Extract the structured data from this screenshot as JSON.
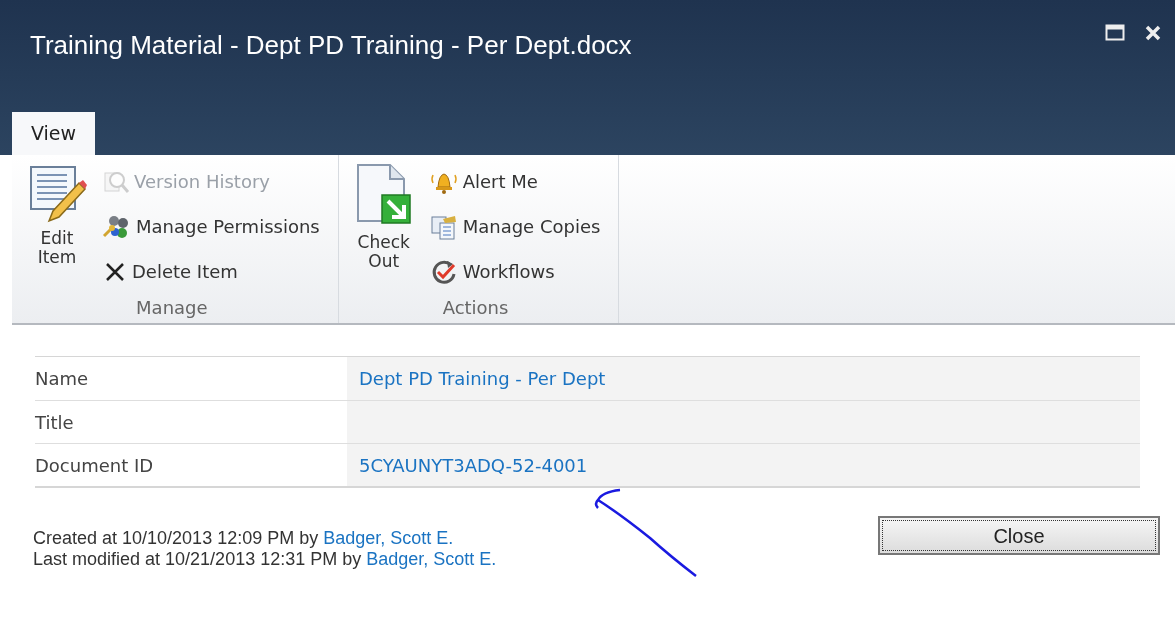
{
  "window": {
    "title": "Training Material - Dept PD Training - Per Dept.docx"
  },
  "tabs": [
    {
      "label": "View",
      "selected": true
    }
  ],
  "ribbon": {
    "groups": [
      {
        "label": "Manage",
        "buttons": [
          {
            "kind": "large",
            "label": "Edit Item",
            "disabled": false
          },
          {
            "kind": "small",
            "label": "Version History",
            "disabled": true
          },
          {
            "kind": "small",
            "label": "Manage Permissions",
            "disabled": false
          },
          {
            "kind": "small",
            "label": "Delete Item",
            "disabled": false
          }
        ]
      },
      {
        "label": "Actions",
        "buttons": [
          {
            "kind": "large",
            "label": "Check Out",
            "disabled": false
          },
          {
            "kind": "small",
            "label": "Alert Me",
            "disabled": false
          },
          {
            "kind": "small",
            "label": "Manage Copies",
            "disabled": false
          },
          {
            "kind": "small",
            "label": "Workflows",
            "disabled": false
          }
        ]
      }
    ]
  },
  "fields": [
    {
      "label": "Name",
      "value": "Dept PD Training - Per Dept"
    },
    {
      "label": "Title"
    },
    {
      "label": "Document ID",
      "value": "5CYAUNYT3ADQ-52-4001"
    }
  ],
  "footer": [
    {
      "text": "Created at 10/10/2013 12:09 PM by",
      "user": "Badger, Scott E."
    },
    {
      "text": "Last modified at 10/21/2013 12:31 PM by",
      "user": "Badger, Scott E."
    }
  ],
  "buttons": [
    "Close"
  ]
}
